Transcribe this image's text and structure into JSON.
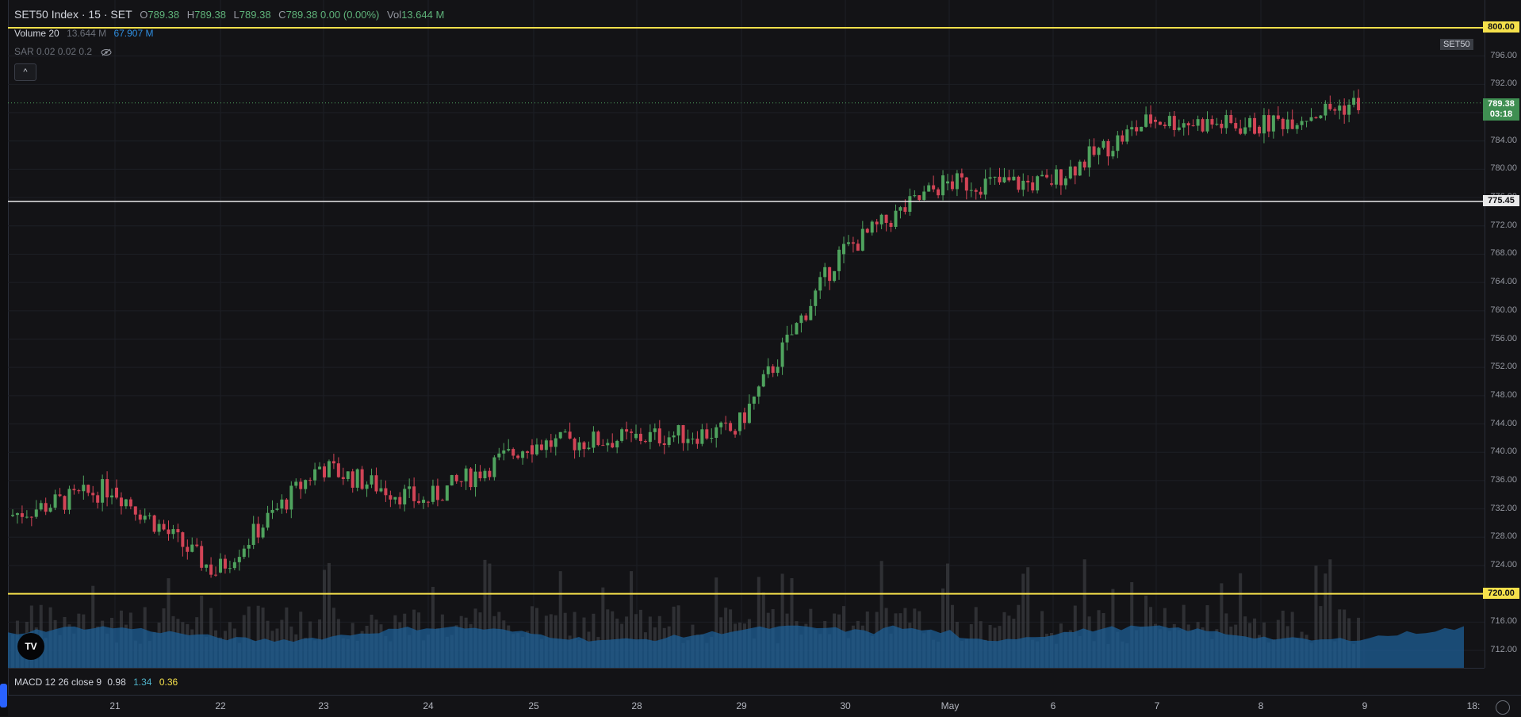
{
  "header": {
    "symbol": "SET50 Index · 15 · SET",
    "open_label": "O",
    "open": "789.38",
    "high_label": "H",
    "high": "789.38",
    "low_label": "L",
    "low": "789.38",
    "close_label": "C",
    "close": "789.38",
    "change": "0.00 (0.00%)",
    "vol_label": "Vol",
    "vol": "13.644 M"
  },
  "volume_indicator": {
    "label": "Volume 20",
    "value": "13.644 M",
    "ma": "67.907 M"
  },
  "sar_indicator": {
    "label": "SAR 0.02 0.02 0.2"
  },
  "collapse_button": {
    "icon": "chevron-up-icon",
    "label": "^"
  },
  "symbol_label": "SET50",
  "price_axis": {
    "ticks": [
      "796.00",
      "792.00",
      "788.00",
      "784.00",
      "780.00",
      "776.00",
      "772.00",
      "768.00",
      "764.00",
      "760.00",
      "756.00",
      "752.00",
      "748.00",
      "744.00",
      "740.00",
      "736.00",
      "732.00",
      "728.00",
      "724.00",
      "720.00",
      "716.00",
      "712.00"
    ],
    "tag_top": "800.00",
    "tag_bottom": "720.00",
    "tag_mid": "775.45",
    "last_price": "789.38",
    "countdown": "03:18"
  },
  "lines": {
    "resistance": 800.0,
    "support": 720.0,
    "mid": 775.45,
    "last": 789.38,
    "colors": {
      "yellow": "#f5e04b",
      "white": "#e9e9ea",
      "up": "#4fa35e",
      "down": "#d24456",
      "volume": "#1e5f96"
    }
  },
  "macd": {
    "label": "MACD 12 26 close 9",
    "macd": "0.98",
    "signal": "1.34",
    "hist": "0.36"
  },
  "time_axis": {
    "labels": [
      "21",
      "22",
      "23",
      "24",
      "25",
      "28",
      "29",
      "30",
      "May",
      "6",
      "7",
      "8",
      "9",
      "18:"
    ]
  },
  "logo": "TV",
  "chart_data": {
    "type": "candlestick",
    "y_range": [
      710.0,
      803.0
    ],
    "sessions": [
      "21",
      "22",
      "23",
      "24",
      "25",
      "28",
      "29",
      "30",
      "May",
      "6",
      "7",
      "8",
      "9"
    ],
    "session_close": [
      735.0,
      723.0,
      738.0,
      733.0,
      741.0,
      742.0,
      743.0,
      768.0,
      778.0,
      778.0,
      787.0,
      786.0,
      789.38
    ],
    "bars_per_session": 22
  }
}
